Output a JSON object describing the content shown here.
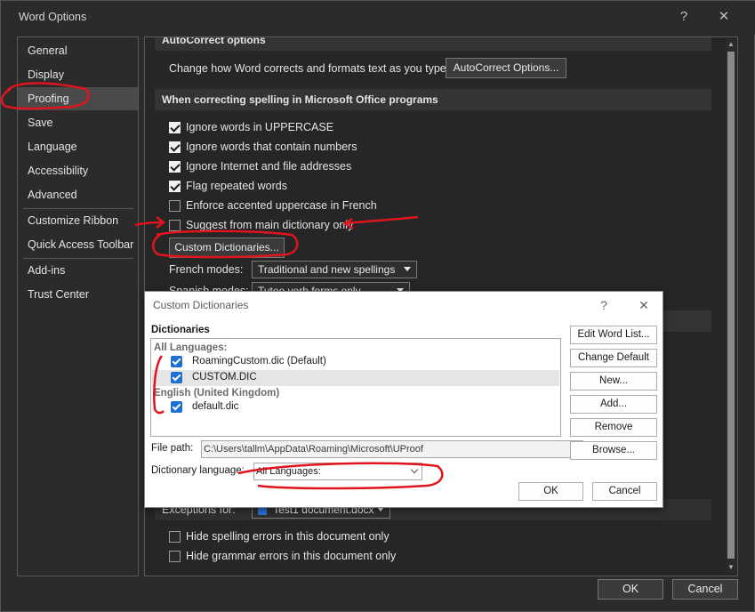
{
  "window": {
    "title": "Word Options",
    "help_glyph": "?",
    "close_glyph": "✕"
  },
  "sidebar": {
    "items": [
      {
        "label": "General"
      },
      {
        "label": "Display"
      },
      {
        "label": "Proofing"
      },
      {
        "label": "Save"
      },
      {
        "label": "Language"
      },
      {
        "label": "Accessibility"
      },
      {
        "label": "Advanced"
      },
      {
        "label": "Customize Ribbon"
      },
      {
        "label": "Quick Access Toolbar"
      },
      {
        "label": "Add-ins"
      },
      {
        "label": "Trust Center"
      }
    ],
    "active_item": "Proofing"
  },
  "main": {
    "autocorrect_header": "AutoCorrect options",
    "autocorrect_text": "Change how Word corrects and formats text as you type:",
    "autocorrect_button": "AutoCorrect Options...",
    "spelling_header": "When correcting spelling in Microsoft Office programs",
    "options": [
      {
        "label": "Ignore words in UPPERCASE",
        "checked": true
      },
      {
        "label": "Ignore words that contain numbers",
        "checked": true
      },
      {
        "label": "Ignore Internet and file addresses",
        "checked": true
      },
      {
        "label": "Flag repeated words",
        "checked": true
      },
      {
        "label": "Enforce accented uppercase in French",
        "checked": false
      },
      {
        "label": "Suggest from main dictionary only",
        "checked": false
      }
    ],
    "custom_dict_button": "Custom Dictionaries...",
    "french_modes_label": "French modes:",
    "french_modes_value": "Traditional and new spellings",
    "spanish_modes_label": "Spanish modes:",
    "spanish_modes_value": "Tuteo verb forms only",
    "exceptions_label": "Exceptions for:",
    "exceptions_value": "Test1 document.docx",
    "exceptions": [
      {
        "label": "Hide spelling errors in this document only",
        "checked": false
      },
      {
        "label": "Hide grammar errors in this document only",
        "checked": false
      }
    ]
  },
  "footer": {
    "ok": "OK",
    "cancel": "Cancel"
  },
  "dialog": {
    "title": "Custom Dictionaries",
    "help_glyph": "?",
    "close_glyph": "✕",
    "dictionaries_label": "Dictionaries",
    "groups": [
      {
        "name": "All Languages:",
        "items": [
          {
            "name": "RoamingCustom.dic (Default)",
            "checked": true,
            "selected": false
          },
          {
            "name": "CUSTOM.DIC",
            "checked": true,
            "selected": true
          }
        ]
      },
      {
        "name": "English (United Kingdom)",
        "items": [
          {
            "name": "default.dic",
            "checked": true,
            "selected": false
          }
        ]
      }
    ],
    "buttons": {
      "edit_word_list": "Edit Word List...",
      "change_default": "Change Default",
      "new": "New...",
      "add": "Add...",
      "remove": "Remove",
      "browse": "Browse..."
    },
    "file_path_label": "File path:",
    "file_path_value": "C:\\Users\\tallm\\AppData\\Roaming\\Microsoft\\UProof",
    "dict_language_label": "Dictionary language:",
    "dict_language_value": "All Languages:",
    "ok": "OK",
    "cancel": "Cancel"
  },
  "colors": {
    "window_bg": "#2b2b2b",
    "panel_bg": "#262626",
    "section_header_bg": "#343434",
    "dialog_bg": "#ffffff",
    "check_blue": "#1f6fd2",
    "annotation_red": "#e0141c"
  }
}
